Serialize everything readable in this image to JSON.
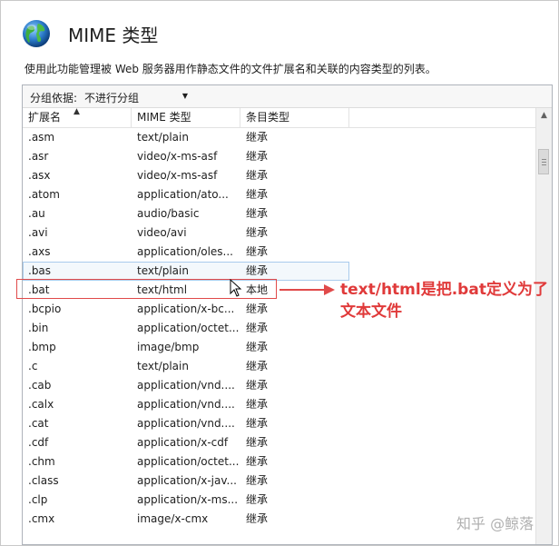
{
  "header": {
    "title": "MIME 类型",
    "globe_icon": "globe-icon"
  },
  "description": "使用此功能管理被 Web 服务器用作静态文件的文件扩展名和关联的内容类型的列表。",
  "groupby": {
    "label": "分组依据:",
    "value": "不进行分组"
  },
  "columns": [
    "扩展名",
    "MIME 类型",
    "条目类型"
  ],
  "rows": [
    [
      ".asm",
      "text/plain",
      "继承"
    ],
    [
      ".asr",
      "video/x-ms-asf",
      "继承"
    ],
    [
      ".asx",
      "video/x-ms-asf",
      "继承"
    ],
    [
      ".atom",
      "application/ato...",
      "继承"
    ],
    [
      ".au",
      "audio/basic",
      "继承"
    ],
    [
      ".avi",
      "video/avi",
      "继承"
    ],
    [
      ".axs",
      "application/oles...",
      "继承"
    ],
    [
      ".bas",
      "text/plain",
      "继承"
    ],
    [
      ".bat",
      "text/html",
      "本地"
    ],
    [
      ".bcpio",
      "application/x-bc...",
      "继承"
    ],
    [
      ".bin",
      "application/octet...",
      "继承"
    ],
    [
      ".bmp",
      "image/bmp",
      "继承"
    ],
    [
      ".c",
      "text/plain",
      "继承"
    ],
    [
      ".cab",
      "application/vnd....",
      "继承"
    ],
    [
      ".calx",
      "application/vnd....",
      "继承"
    ],
    [
      ".cat",
      "application/vnd....",
      "继承"
    ],
    [
      ".cdf",
      "application/x-cdf",
      "继承"
    ],
    [
      ".chm",
      "application/octet...",
      "继承"
    ],
    [
      ".class",
      "application/x-jav...",
      "继承"
    ],
    [
      ".clp",
      "application/x-ms...",
      "继承"
    ],
    [
      ".cmx",
      "image/x-cmx",
      "继承"
    ]
  ],
  "annotation": {
    "text": "text/html是把.bat定义为了文本文件",
    "color": "#e03a3a"
  },
  "watermark": "知乎 @鲸落"
}
